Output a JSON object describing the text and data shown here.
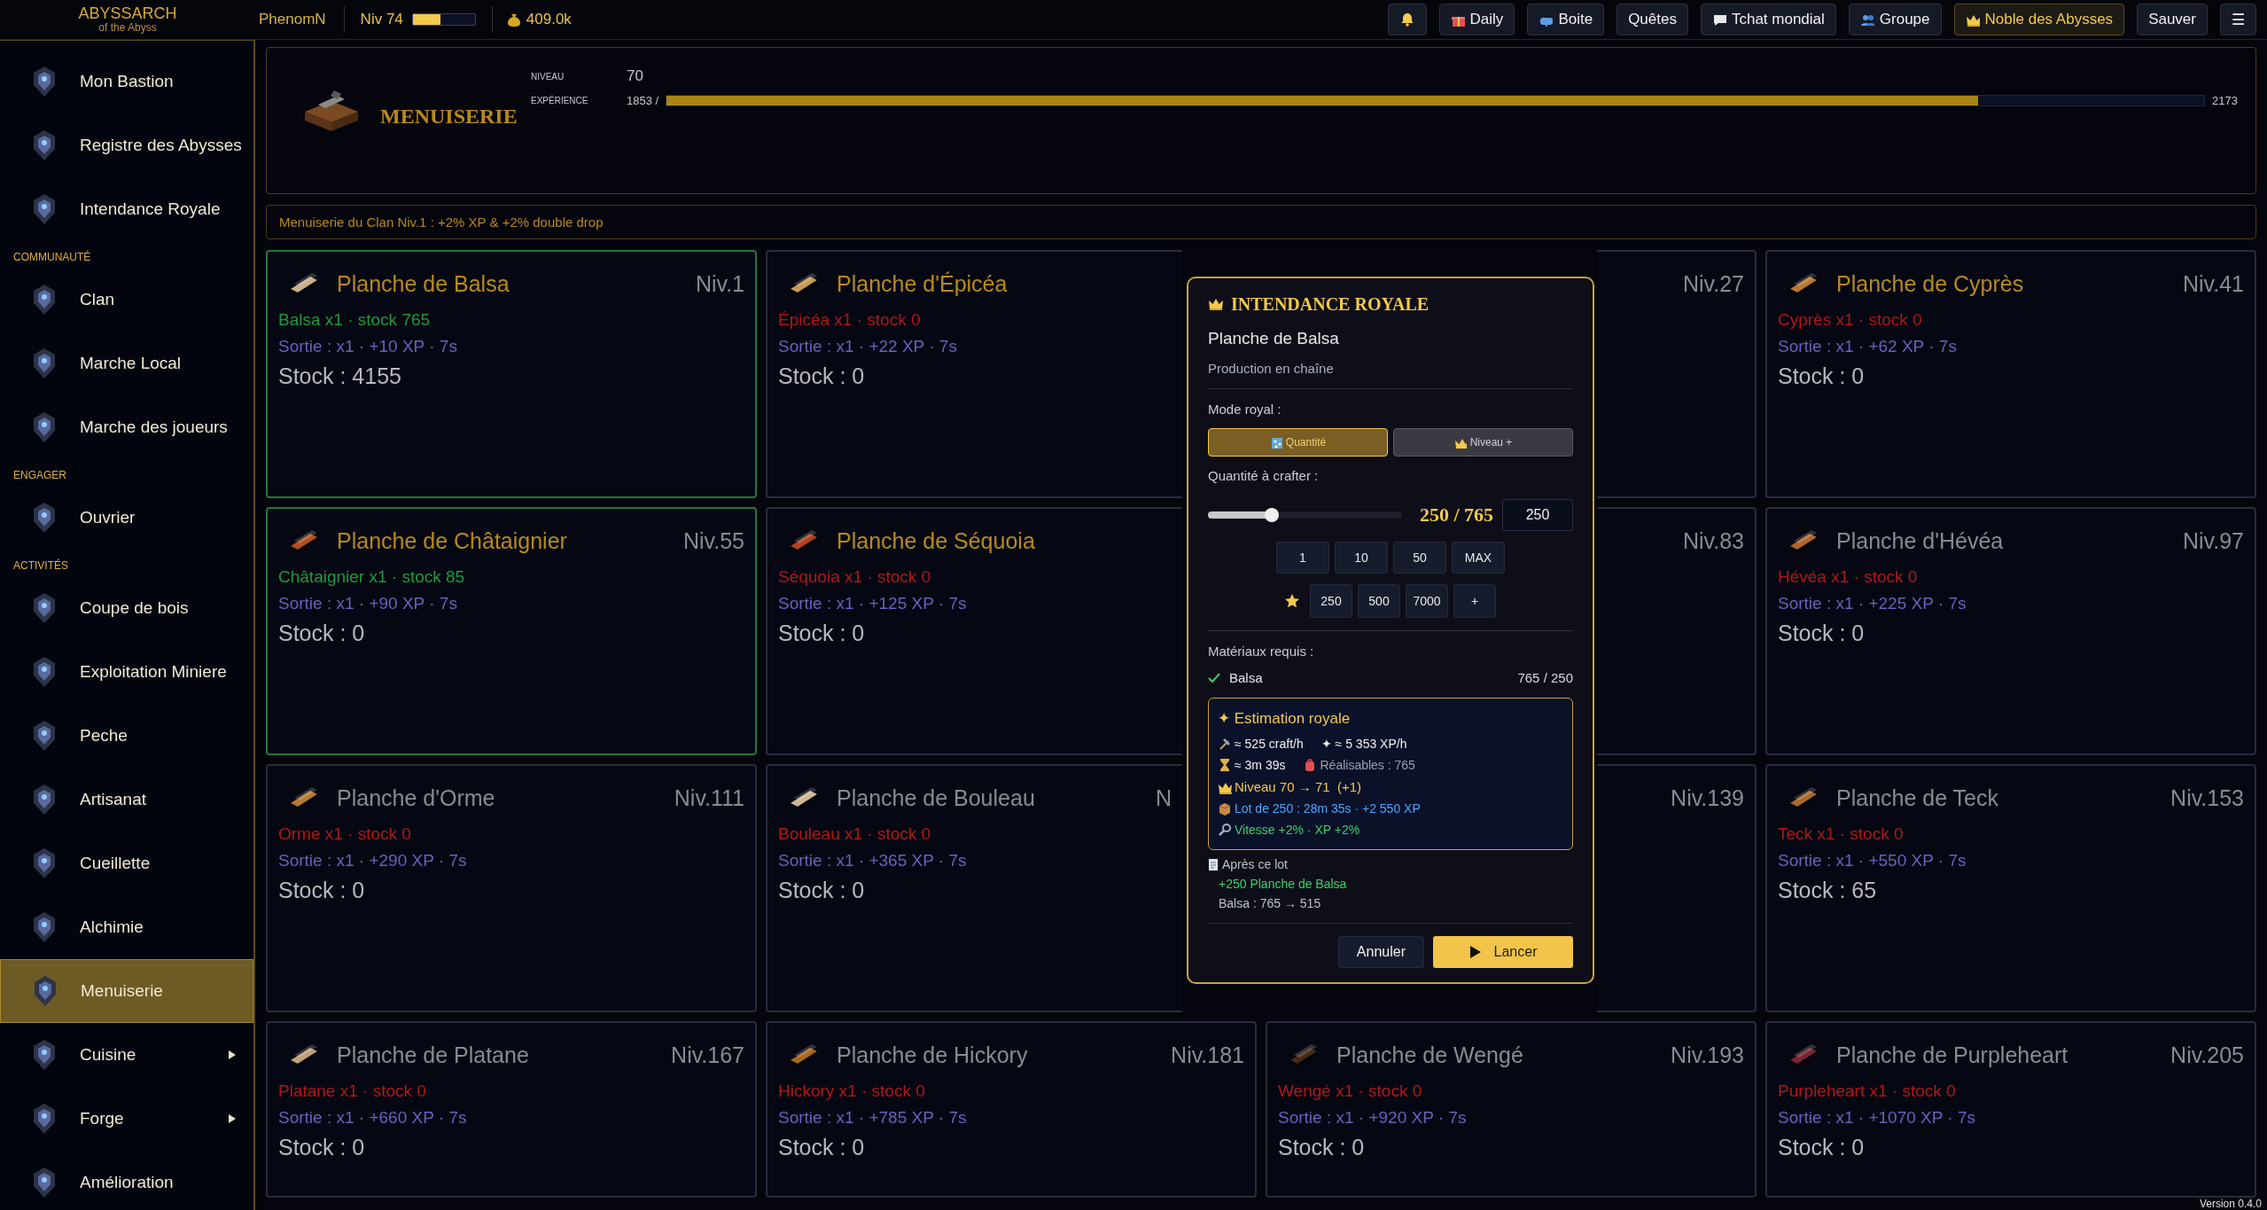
{
  "topbar": {
    "logo": {
      "title": "ABYSSARCH",
      "subtitle": "of the Abyss"
    },
    "player": "PhenomN",
    "player_level": "Niv 74",
    "player_xp": {
      "level": 0.45
    },
    "gold": "409.0k",
    "buttons": [
      {
        "kind": "bell"
      },
      {
        "kind": "gift",
        "label": "Daily"
      },
      {
        "kind": "mail",
        "label": "Boite"
      },
      {
        "kind": "plain",
        "label": "Quêtes"
      },
      {
        "kind": "chat",
        "label": "Tchat mondial"
      },
      {
        "kind": "group",
        "label": "Groupe"
      },
      {
        "kind": "crown",
        "label": "Noble des Abysses"
      },
      {
        "kind": "plain",
        "label": "Sauver"
      },
      {
        "kind": "plain",
        "label": "☰"
      }
    ]
  },
  "sidebar": {
    "groups": [
      {
        "items": [
          {
            "label": "Mon Bastion",
            "selected": false,
            "submenu": false
          },
          {
            "label": "Registre des Abysses",
            "selected": false,
            "submenu": false
          },
          {
            "label": "Intendance Royale",
            "selected": false,
            "submenu": false
          }
        ]
      },
      {
        "heading": "COMMUNAUTÉ",
        "items": [
          {
            "label": "Clan",
            "selected": false,
            "submenu": false
          },
          {
            "label": "Marche Local",
            "selected": false,
            "submenu": false
          },
          {
            "label": "Marche des joueurs",
            "selected": false,
            "submenu": false
          }
        ]
      },
      {
        "heading": "ENGAGER",
        "items": [
          {
            "label": "Ouvrier",
            "selected": false,
            "submenu": false
          }
        ]
      },
      {
        "heading": "ACTIVITÉS",
        "items": [
          {
            "label": "Coupe de bois",
            "selected": false,
            "submenu": false
          },
          {
            "label": "Exploitation Miniere",
            "selected": false,
            "submenu": false
          },
          {
            "label": "Peche",
            "selected": false,
            "submenu": false
          },
          {
            "label": "Artisanat",
            "selected": false,
            "submenu": false
          },
          {
            "label": "Cueillette",
            "selected": false,
            "submenu": false
          },
          {
            "label": "Alchimie",
            "selected": false,
            "submenu": false
          },
          {
            "label": "Menuiserie",
            "selected": true,
            "submenu": false
          },
          {
            "label": "Cuisine",
            "selected": false,
            "submenu": true
          },
          {
            "label": "Forge",
            "selected": false,
            "submenu": true
          },
          {
            "label": "Amélioration",
            "selected": false,
            "submenu": false
          }
        ]
      }
    ]
  },
  "skill": {
    "title": "MENUISERIE",
    "level_label": "NIVEAU",
    "level": "70",
    "xp_label": "EXPÉRIENCE",
    "xp": "1853 /",
    "xp_bar": {
      "level": 0.853
    },
    "xp_max": "2173"
  },
  "clan_bonus": "Menuiserie du Clan Niv.1 : +2% XP & +2% double drop",
  "recipes": [
    {
      "title": "Planche de Balsa",
      "level": "Niv.1",
      "material": "Balsa x1 · stock 765",
      "output": "Sortie : x1 · +10 XP · 7s",
      "stock": "Stock : 4155",
      "unlocked": true,
      "craftable": true,
      "color": "#c8b08a"
    },
    {
      "title": "Planche d'Épicéa",
      "material": "Épicéa x1 · stock 0",
      "output": "Sortie : x1 · +22 XP · 7s",
      "stock": "Stock : 0",
      "unlocked": true,
      "craftable": false,
      "color": "#c89a50"
    },
    {
      "level": "Niv.27"
    },
    {
      "title": "Planche de Cyprès",
      "level": "Niv.41",
      "material": "Cyprès x1 · stock 0",
      "output": "Sortie : x1 · +62 XP · 7s",
      "stock": "Stock : 0",
      "unlocked": true,
      "craftable": false,
      "color": "#b8782e"
    },
    {
      "title": "Planche de Châtaignier",
      "level": "Niv.55",
      "material": "Châtaignier x1 · stock 85",
      "output": "Sortie : x1 · +90 XP · 7s",
      "stock": "Stock : 0",
      "unlocked": true,
      "craftable": true,
      "color": "#b4501e"
    },
    {
      "title": "Planche de Séquoia",
      "material": "Séquoia x1 · stock 0",
      "output": "Sortie : x1 · +125 XP · 7s",
      "stock": "Stock : 0",
      "unlocked": true,
      "craftable": false,
      "color": "#b4401c"
    },
    {
      "level": "Niv.83"
    },
    {
      "title": "Planche d'Hévéa",
      "level": "Niv.97",
      "material": "Hévéa x1 · stock 0",
      "output": "Sortie : x1 · +225 XP · 7s",
      "stock": "Stock : 0",
      "unlocked": false,
      "craftable": false,
      "color": "#b0642a"
    },
    {
      "title": "Planche d'Orme",
      "level": "Niv.111",
      "material": "Orme x1 · stock 0",
      "output": "Sortie : x1 · +290 XP · 7s",
      "stock": "Stock : 0",
      "unlocked": false,
      "craftable": false,
      "color": "#b87a30"
    },
    {
      "title": "Planche de Bouleau",
      "level": "N",
      "material": "Bouleau x1 · stock 0",
      "output": "Sortie : x1 · +365 XP · 7s",
      "stock": "Stock : 0",
      "unlocked": false,
      "craftable": false,
      "color": "#cdb894"
    },
    {
      "level": "Niv.139"
    },
    {
      "title": "Planche de Teck",
      "level": "Niv.153",
      "material": "Teck x1 · stock 0",
      "output": "Sortie : x1 · +550 XP · 7s",
      "stock": "Stock : 65",
      "unlocked": false,
      "craftable": false,
      "color": "#a9682c"
    },
    {
      "title": "Planche de Platane",
      "level": "Niv.167",
      "material": "Platane x1 · stock 0",
      "output": "Sortie : x1 · +660 XP · 7s",
      "stock": "Stock : 0",
      "unlocked": false,
      "craftable": false,
      "color": "#bfa07a"
    },
    {
      "title": "Planche de Hickory",
      "level": "Niv.181",
      "material": "Hickory x1 · stock 0",
      "output": "Sortie : x1 · +785 XP · 7s",
      "stock": "Stock : 0",
      "unlocked": false,
      "craftable": false,
      "color": "#a8661e"
    },
    {
      "title": "Planche de Wengé",
      "level": "Niv.193",
      "material": "Wengé x1 · stock 0",
      "output": "Sortie : x1 · +920 XP · 7s",
      "stock": "Stock : 0",
      "unlocked": false,
      "craftable": false,
      "color": "#4a2a14"
    },
    {
      "title": "Planche de Purpleheart",
      "level": "Niv.205",
      "material": "Purpleheart x1 · stock 0",
      "output": "Sortie : x1 · +1070 XP · 7s",
      "stock": "Stock : 0",
      "unlocked": false,
      "craftable": false,
      "color": "#7a2430"
    }
  ],
  "dialog": {
    "title": "INTENDANCE ROYALE",
    "item": "Planche de Balsa",
    "subtitle": "Production en chaîne",
    "mode_label": "Mode royal :",
    "modes": [
      {
        "kind": "abacus",
        "label": "Quantité",
        "selected": true
      },
      {
        "kind": "crown",
        "label": "Niveau +",
        "selected": false
      }
    ],
    "quantity_label": "Quantité à crafter :",
    "slider": {
      "level": 0.33
    },
    "ratio": "250 / 765",
    "quantity": "250",
    "presets": [
      "1",
      "10",
      "50",
      "MAX"
    ],
    "favorites": [
      "250",
      "500",
      "7000",
      "+"
    ],
    "materials_label": "Matériaux requis :",
    "materials": [
      {
        "name": "Balsa",
        "amount": "765 / 250",
        "ok": true
      }
    ],
    "estimate": {
      "title": "✦ Estimation royale",
      "rate": "≈ 525 craft/h",
      "xp_rate": "✦ ≈ 5 353 XP/h",
      "duration": "≈ 3m 39s",
      "feasible": "Réalisables : 765",
      "level": "Niveau 70 → 71  (+1)",
      "batch": "Lot de 250 : 28m 35s · +2 550 XP",
      "bonus": "Vitesse +2% · XP +2%"
    },
    "after_label": "Après ce lot",
    "after_gain": "+250 Planche de Balsa",
    "after_stock": "Balsa : 765 → 515",
    "cancel": "Annuler",
    "launch": "Lancer"
  },
  "version": "Version 0.4.0"
}
